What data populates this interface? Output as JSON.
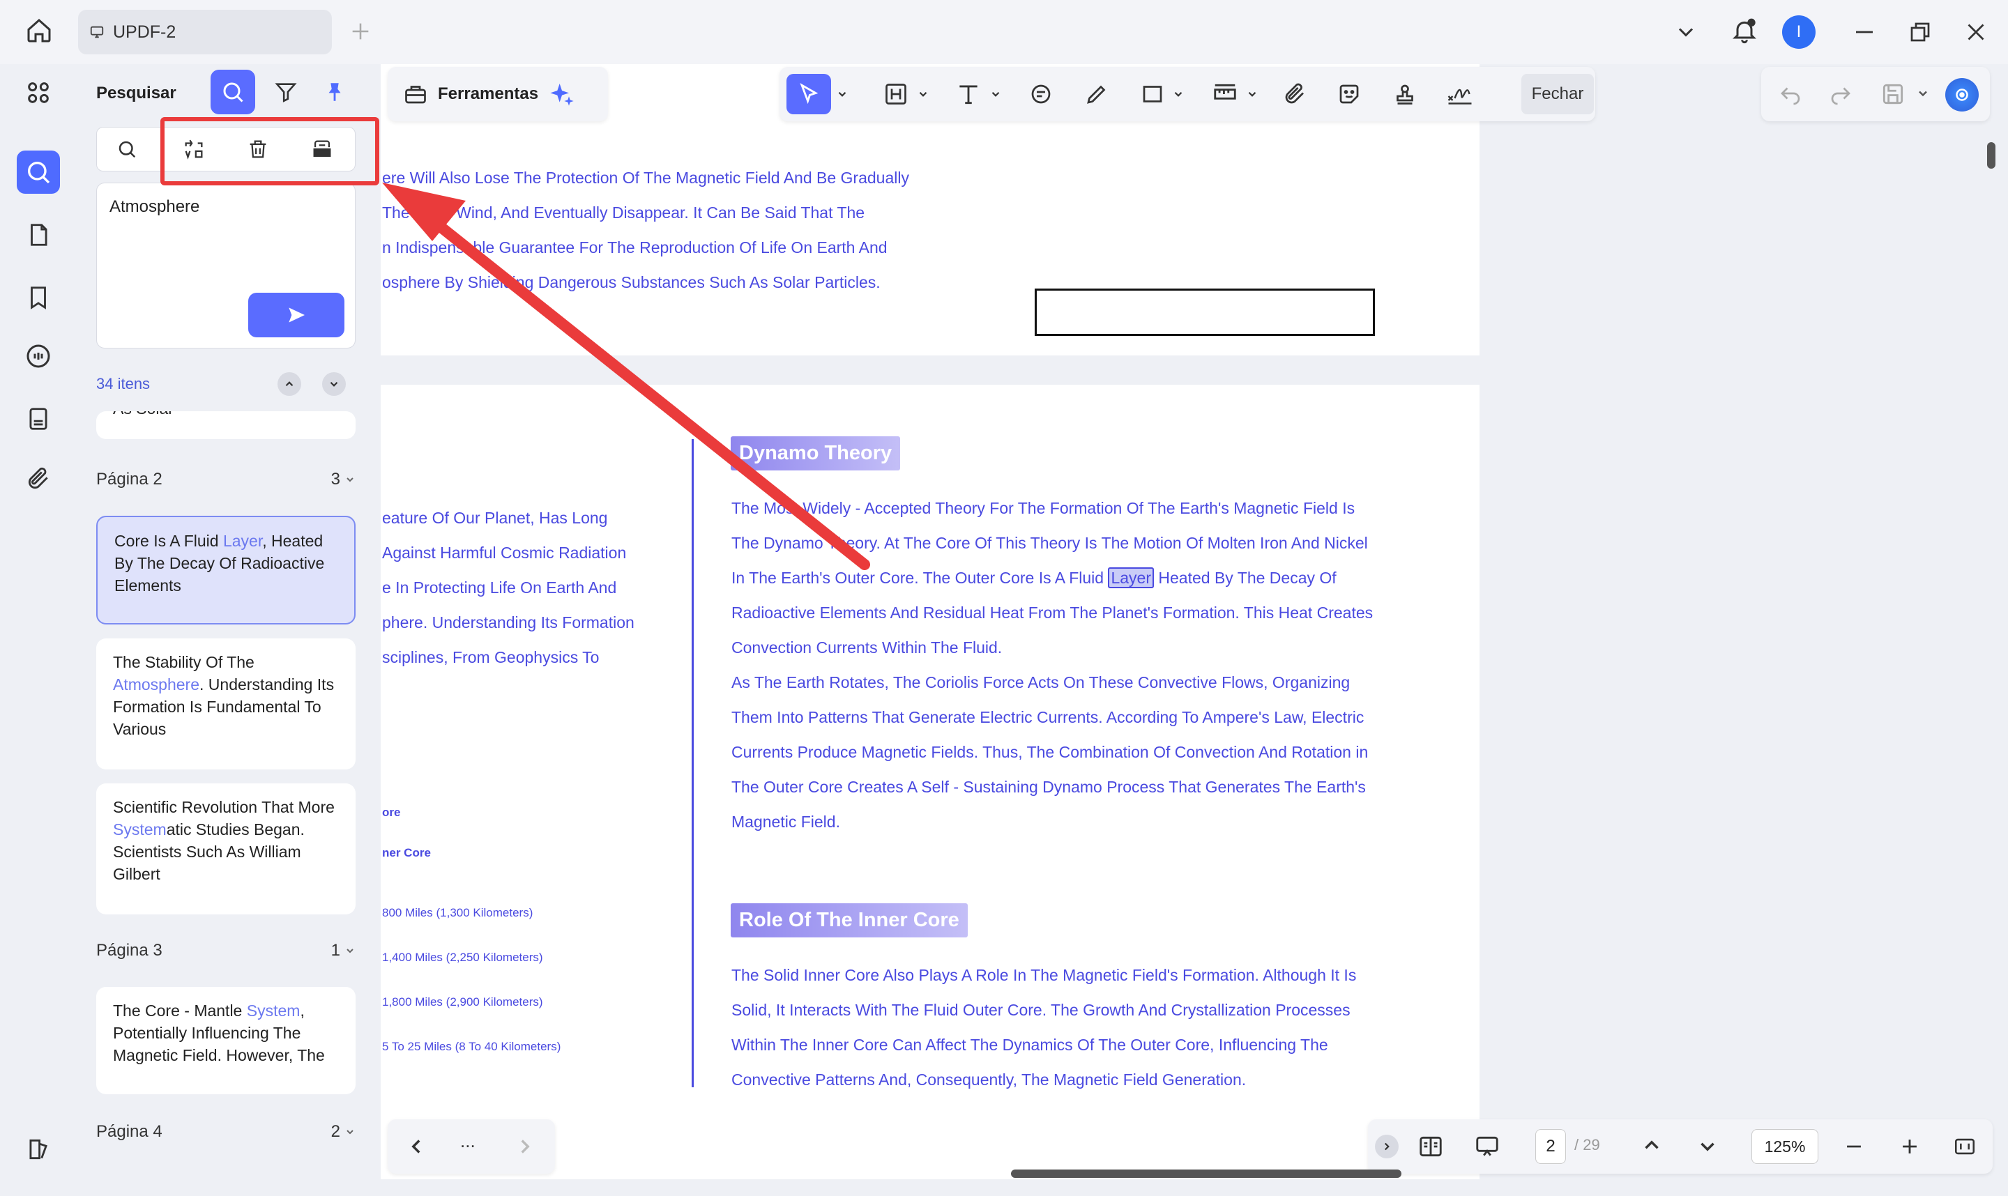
{
  "window": {
    "tab_title": "UPDF-2",
    "avatar_initial": "I"
  },
  "panel": {
    "title": "Pesquisar",
    "query": "Atmosphere",
    "count": "34 itens",
    "results": [
      {
        "page_label": "Página 2",
        "page_count": "3",
        "items": [
          {
            "pre": "Core Is A Fluid ",
            "hit": "Layer",
            "post": ", Heated By The Decay Of Radioactive Elements"
          },
          {
            "pre": "The Stability Of The ",
            "hit": "Atmosphere",
            "post": ". Understanding Its Formation Is Fundamental To Various"
          },
          {
            "pre": "Scientific Revolution That More ",
            "hit": "System",
            "post": "atic Studies Began. Scientists Such As William Gilbert"
          }
        ]
      },
      {
        "page_label": "Página 3",
        "page_count": "1",
        "items": [
          {
            "pre": "The Core - Mantle ",
            "hit": "System",
            "post": ", Potentially Influencing The Magnetic Field. However, The"
          }
        ]
      },
      {
        "page_label": "Página 4",
        "page_count": "2",
        "items": []
      }
    ],
    "partial_top_item": "As Solar"
  },
  "toolbar": {
    "tools_label": "Ferramentas",
    "close_label": "Fechar"
  },
  "document": {
    "page1_lines": [
      "ere Will Also Lose The Protection Of The Magnetic Field And Be Gradually",
      "The Solar Wind, And Eventually Disappear. It Can Be Said That The",
      "n Indispensable Guarantee For The Reproduction Of Life On Earth And",
      "osphere By Shielding Dangerous Substances Such As Solar Particles."
    ],
    "page2_left_lines": [
      "eature Of Our Planet, Has Long",
      "Against Harmful Cosmic Radiation",
      "e In Protecting Life On Earth And",
      "phere. Understanding Its Formation",
      "sciplines, From Geophysics To"
    ],
    "page2_left_small": [
      "ore",
      "ner Core",
      "800 Miles (1,300 Kilometers)",
      "1,400 Miles (2,250 Kilometers)",
      "1,800 Miles (2,900 Kilometers)",
      "5 To 25 Miles (8 To 40 Kilometers)"
    ],
    "heading1": "Dynamo Theory",
    "dynamo_lines": [
      "The Most Widely - Accepted Theory For The Formation Of The Earth's Magnetic Field Is",
      "The Dynamo Theory. At The Core Of This Theory Is The Motion Of Molten Iron And Nickel",
      "In The Earth's Outer Core. The Outer Core Is A Fluid ",
      "Radioactive Elements And Residual Heat From The Planet's Formation. This Heat Creates",
      "Convection Currents Within The Fluid.",
      "As The Earth Rotates, The Coriolis Force Acts On These Convective Flows, Organizing",
      "Them Into Patterns That Generate Electric Currents. According To Ampere's Law, Electric",
      "Currents Produce Magnetic Fields. Thus, The Combination Of Convection And Rotation in",
      "The Outer Core Creates A Self - Sustaining Dynamo Process That Generates The Earth's",
      "Magnetic Field."
    ],
    "dynamo_hit": "Layer",
    "dynamo_hit_tail": " Heated By The Decay Of",
    "heading2": "Role Of The Inner Core",
    "inner_lines": [
      "The Solid Inner Core Also Plays A Role In The Magnetic Field's Formation. Although It Is",
      "Solid, It Interacts With The Fluid Outer Core. The Growth And Crystallization Processes",
      "Within The Inner Core Can Affect The Dynamics Of The Outer Core, Influencing The",
      "Convective Patterns And, Consequently, The Magnetic Field Generation."
    ]
  },
  "footer": {
    "current_page": "2",
    "total_pages": "/ 29",
    "zoom": "125%",
    "more": "..."
  },
  "colors": {
    "accent": "#5a6cff",
    "annotation_red": "#ea3b3b",
    "doc_text": "#4a4ae0"
  }
}
